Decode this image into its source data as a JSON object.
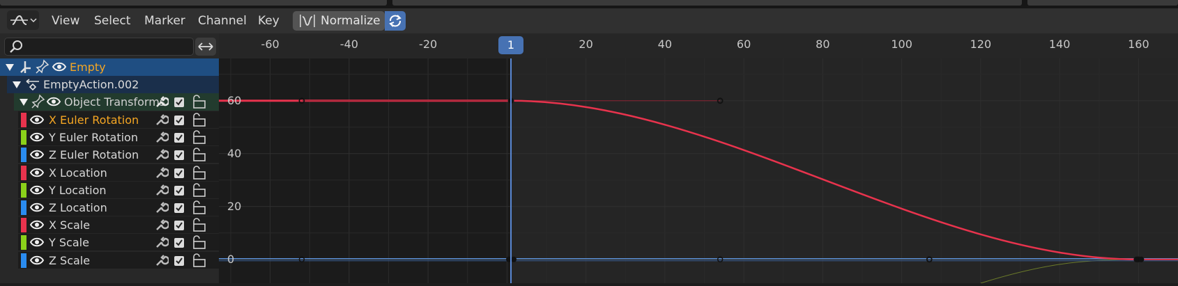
{
  "header": {
    "menus": [
      "View",
      "Select",
      "Marker",
      "Channel",
      "Key"
    ],
    "normalize_label": "Normalize"
  },
  "search": {
    "placeholder": "",
    "value": ""
  },
  "channels": {
    "object": "Empty",
    "action": "EmptyAction.002",
    "group": "Object Transforms",
    "items": [
      {
        "label": "X Euler Rotation",
        "color": "#e8334d",
        "selected": true
      },
      {
        "label": "Y Euler Rotation",
        "color": "#8bd11a",
        "selected": false
      },
      {
        "label": "Z Euler Rotation",
        "color": "#2a8cf0",
        "selected": false
      },
      {
        "label": "X Location",
        "color": "#e8334d",
        "selected": false
      },
      {
        "label": "Y Location",
        "color": "#8bd11a",
        "selected": false
      },
      {
        "label": "Z Location",
        "color": "#2a8cf0",
        "selected": false
      },
      {
        "label": "X Scale",
        "color": "#e8334d",
        "selected": false
      },
      {
        "label": "Y Scale",
        "color": "#8bd11a",
        "selected": false
      },
      {
        "label": "Z Scale",
        "color": "#2a8cf0",
        "selected": false
      }
    ]
  },
  "timeline": {
    "current_frame": "1",
    "x_ticks": [
      "-60",
      "-40",
      "-20",
      "20",
      "40",
      "60",
      "80",
      "100",
      "120",
      "140",
      "160"
    ],
    "y_ticks": [
      "60",
      "40",
      "20",
      "0"
    ]
  },
  "chart_data": {
    "type": "line",
    "x_range": [
      -73,
      170
    ],
    "y_range": [
      -9,
      76
    ],
    "series": [
      {
        "name": "X Euler Rotation",
        "color": "#e8334d",
        "keyframes": [
          [
            1,
            60
          ],
          [
            160,
            0
          ]
        ],
        "handles": [
          [
            -52,
            60
          ],
          [
            54,
            60
          ],
          [
            107,
            0
          ]
        ]
      },
      {
        "name": "Z Euler Rotation",
        "color": "#5a8fd6",
        "keyframes": [
          [
            1,
            0
          ],
          [
            160,
            0
          ]
        ],
        "handles": [
          [
            -52,
            0
          ],
          [
            54,
            0
          ],
          [
            107,
            0
          ]
        ]
      }
    ]
  },
  "colors": {
    "accent": "#4772b3",
    "selected_text": "#f5a623",
    "curve_x": "#e8334d"
  }
}
